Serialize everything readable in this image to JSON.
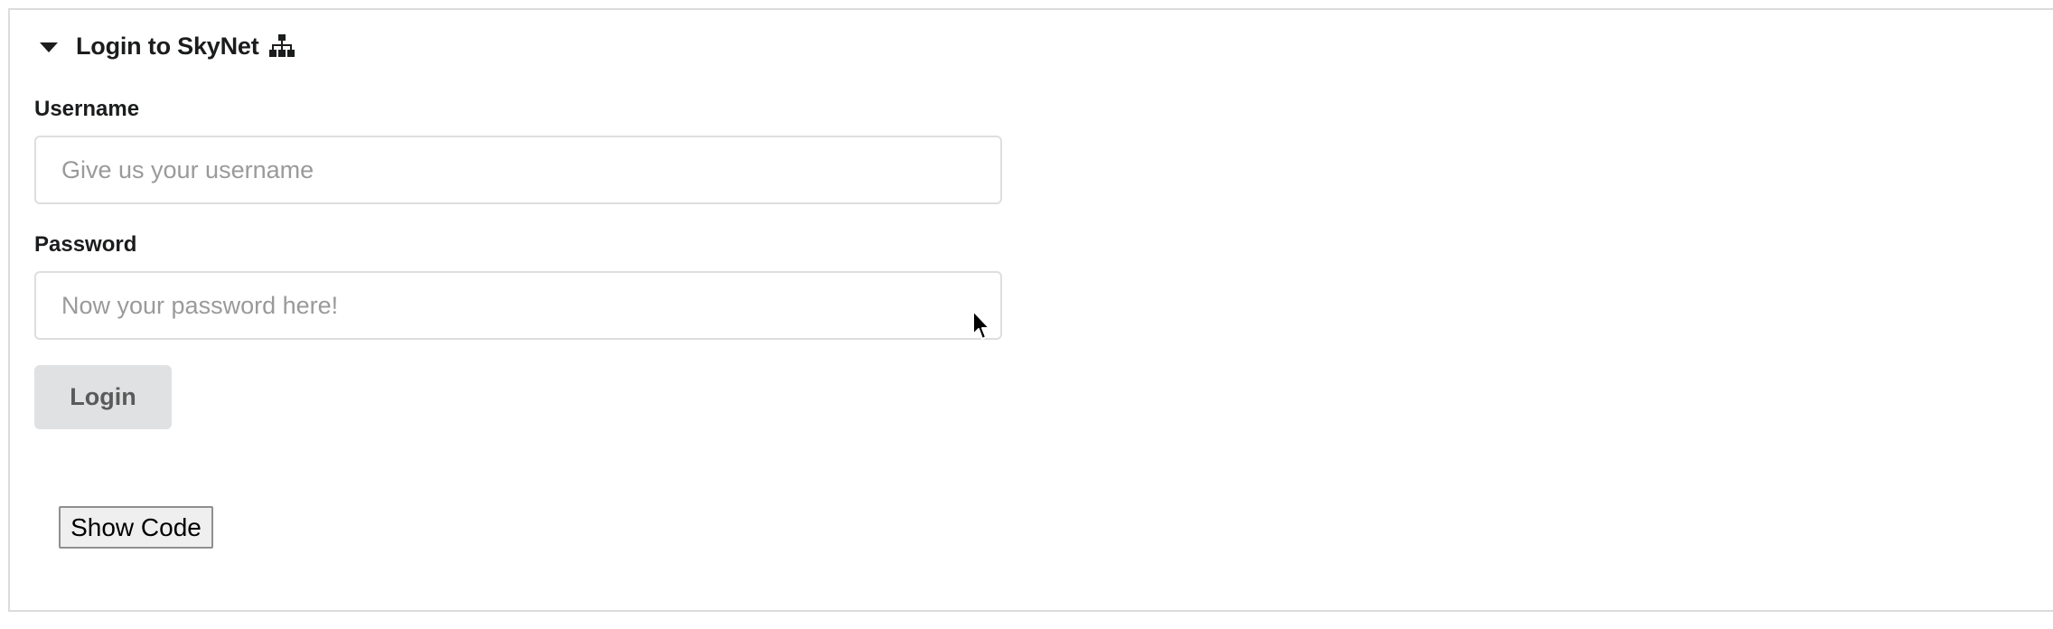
{
  "form": {
    "title": "Login to SkyNet",
    "title_icon": "sitemap-icon",
    "username_label": "Username",
    "username_placeholder": "Give us your username",
    "username_value": "",
    "password_label": "Password",
    "password_placeholder": "Now your password here!",
    "password_value": "",
    "login_label": "Login"
  },
  "footer": {
    "show_code_label": "Show Code"
  },
  "colors": {
    "button_bg": "#e0e1e2",
    "border": "#dededf",
    "placeholder": "#9a9a9a"
  }
}
